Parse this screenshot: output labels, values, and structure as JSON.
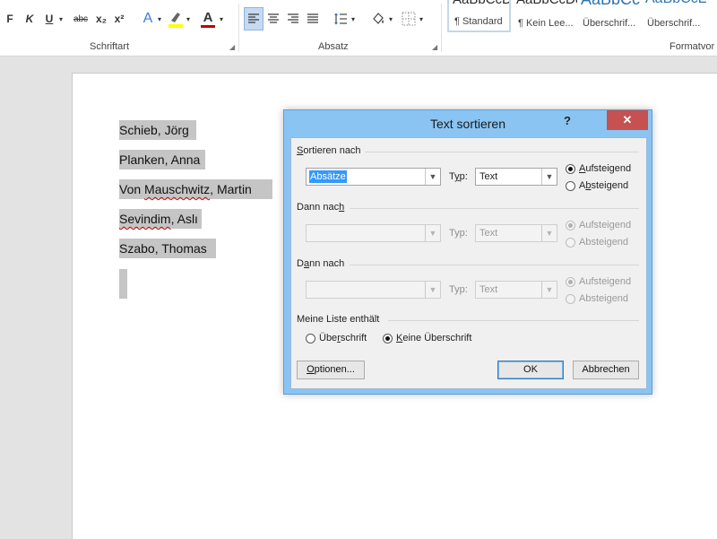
{
  "ribbon": {
    "font_buttons": [
      "F",
      "K",
      "U",
      "abc",
      "x₂",
      "x²",
      "A",
      "A"
    ],
    "group_schriftart": "Schriftart",
    "group_absatz": "Absatz",
    "group_formatvorlagen": "Formatvor",
    "styles": [
      {
        "preview": "AaBbCcDc",
        "name": "¶ Standard"
      },
      {
        "preview": "AaBbCcDc",
        "name": "¶ Kein Lee..."
      },
      {
        "preview": "AaBbCc",
        "name": "Überschrif..."
      },
      {
        "preview": "AaBbCcE",
        "name": "Überschrif..."
      }
    ]
  },
  "document": {
    "lines": [
      {
        "pre": "Schieb, Jörg",
        "sq": "",
        "post": ""
      },
      {
        "pre": "Planken, Anna",
        "sq": "",
        "post": ""
      },
      {
        "pre": "Von ",
        "sq": "Mauschwitz",
        "post": ", Martin"
      },
      {
        "pre": "",
        "sq": "Sevindim",
        "post": ", Aslı"
      },
      {
        "pre": "Szabo, Thomas",
        "sq": "",
        "post": ""
      }
    ]
  },
  "dialog": {
    "title": "Text sortieren",
    "help": "?",
    "close": "✕",
    "section1": {
      "pre": "",
      "u": "S",
      "post": "ortieren nach"
    },
    "sort1": {
      "value": "Absätze",
      "typ_pre": "T",
      "typ_u": "y",
      "typ_post": "p:",
      "typ_value": "Text",
      "asc_u": "A",
      "asc_post": "ufsteigend",
      "desc_pre": "A",
      "desc_u": "b",
      "desc_post": "steigend"
    },
    "section2": {
      "pre": "Dann nac",
      "u": "h",
      "post": ""
    },
    "sort2": {
      "value": "",
      "typ": "Typ:",
      "typ_value": "Text",
      "asc": "Aufsteigend",
      "desc": "Absteigend"
    },
    "section3": {
      "pre": "D",
      "u": "a",
      "post": "nn nach"
    },
    "sort3": {
      "value": "",
      "typ": "Typ:",
      "typ_value": "Text",
      "asc": "Aufsteigend",
      "desc": "Absteigend"
    },
    "list_section": "Meine Liste enthält",
    "header_option": {
      "pre": "Übe",
      "u": "r",
      "post": "schrift"
    },
    "noheader_option": {
      "pre": "",
      "u": "K",
      "post": "eine Überschrift"
    },
    "options_button": {
      "pre": "",
      "u": "O",
      "post": "ptionen..."
    },
    "ok_button": "OK",
    "cancel_button": "Abbrechen"
  }
}
